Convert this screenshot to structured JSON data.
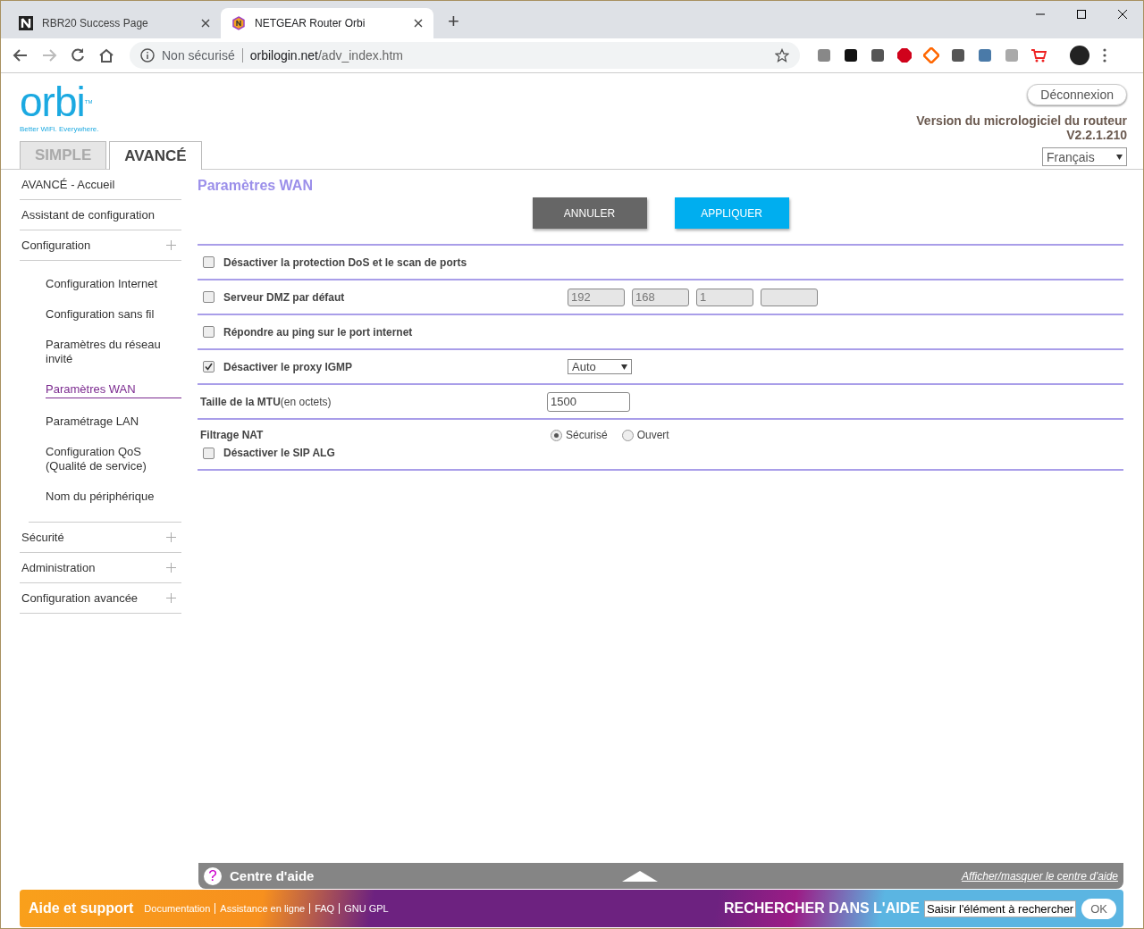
{
  "browser": {
    "tabs": [
      {
        "title": "RBR20 Success Page",
        "selected": false,
        "kind": "n"
      },
      {
        "title": "NETGEAR Router Orbi",
        "selected": true,
        "kind": "netgear"
      }
    ],
    "new_tab": "+",
    "address": {
      "security": "Non sécurisé",
      "host": "orbilogin.net",
      "path": "/adv_index.htm"
    }
  },
  "header": {
    "wordmark": "orbi",
    "tm": "TM",
    "tagline": "Better WiFi. Everywhere.",
    "logout": "Déconnexion",
    "firmware_label": "Version du micrologiciel du routeur",
    "firmware_version": "V2.2.1.210",
    "language": "Français"
  },
  "mode_tabs": [
    {
      "label": "SIMPLE",
      "selected": false
    },
    {
      "label": "AVANCÉ",
      "selected": true
    }
  ],
  "sidebar": {
    "items": [
      {
        "label": "AVANCÉ - Accueil",
        "kind": "link"
      },
      {
        "label": "Assistant de configuration",
        "kind": "link"
      },
      {
        "label": "Configuration",
        "kind": "group",
        "children": [
          {
            "label": "Configuration Internet",
            "selected": false
          },
          {
            "label": "Configuration sans fil",
            "selected": false
          },
          {
            "label": "Paramètres du réseau invité",
            "selected": false
          },
          {
            "label": "Paramètres WAN",
            "selected": true
          },
          {
            "label": "Paramétrage LAN",
            "selected": false
          },
          {
            "label": "Configuration QoS (Qualité de service)",
            "selected": false
          },
          {
            "label": "Nom du périphérique",
            "selected": false
          }
        ]
      },
      {
        "label": "Sécurité",
        "kind": "group"
      },
      {
        "label": "Administration",
        "kind": "group"
      },
      {
        "label": "Configuration avancée",
        "kind": "group"
      }
    ]
  },
  "page": {
    "title": "Paramètres WAN",
    "buttons": [
      {
        "label": "ANNULER",
        "kind": "secondary"
      },
      {
        "label": "APPLIQUER",
        "kind": "primary"
      }
    ],
    "settings": [
      {
        "kind": "checkbox",
        "label": "Désactiver la protection DoS et le scan de ports",
        "checked": false
      },
      {
        "kind": "ip",
        "label": "Serveur DMZ par défaut",
        "checked": false,
        "octets": [
          "192",
          "168",
          "1"
        ]
      },
      {
        "kind": "checkbox",
        "label": "Répondre au ping sur le port internet",
        "checked": false
      },
      {
        "kind": "select",
        "label": "Désactiver le proxy IGMP",
        "checked": true,
        "value": "Auto"
      },
      {
        "kind": "text",
        "label": "**Taille de la MTU**(en octets)",
        "value": "1500"
      },
      {
        "kind": "nat",
        "label": "Filtrage NAT",
        "options": [
          {
            "label": "Sécurisé",
            "selected": true
          },
          {
            "label": "Ouvert",
            "selected": false
          }
        ],
        "sub_label": "Désactiver le SIP ALG",
        "sub_checked": false
      }
    ]
  },
  "help_bar": {
    "icon": "?",
    "title": "Centre d'aide",
    "toggle": "Afficher/masquer le centre d'aide"
  },
  "footer": {
    "title": "Aide et support",
    "links": [
      "Documentation",
      "Assistance en ligne",
      "FAQ",
      "GNU GPL"
    ],
    "search_label": "RECHERCHER DANS L'AIDE",
    "search_value": "Saisir l'élément à rechercher",
    "ok": "OK"
  }
}
